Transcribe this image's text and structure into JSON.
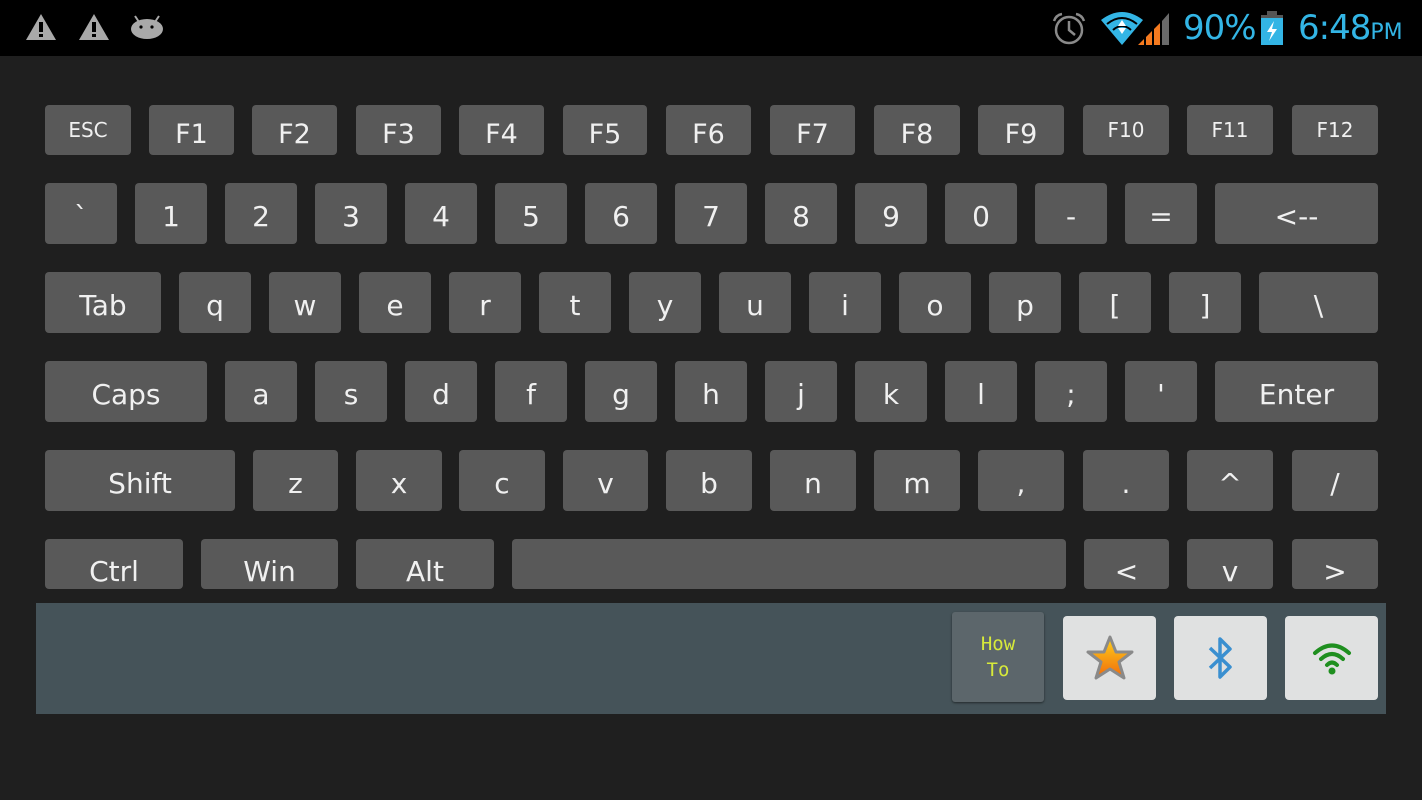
{
  "status_bar": {
    "left_icons": [
      "warning-icon",
      "warning-icon",
      "android-debug-icon"
    ],
    "right_icons": [
      "alarm-icon",
      "wifi-icon",
      "cell-signal-icon",
      "battery-charging-icon"
    ],
    "battery_percent": "90%",
    "time": "6:48",
    "ampm": "PM",
    "accent_color": "#33b5e5"
  },
  "keyboard": {
    "row_function": [
      "ESC",
      "F1",
      "F2",
      "F3",
      "F4",
      "F5",
      "F6",
      "F7",
      "F8",
      "F9",
      "F10",
      "F11",
      "F12"
    ],
    "row_number": [
      "`",
      "1",
      "2",
      "3",
      "4",
      "5",
      "6",
      "7",
      "8",
      "9",
      "0",
      "-",
      "=",
      "<--"
    ],
    "row_qwerty": [
      "Tab",
      "q",
      "w",
      "e",
      "r",
      "t",
      "y",
      "u",
      "i",
      "o",
      "p",
      "[",
      "]",
      "\\"
    ],
    "row_home": [
      "Caps",
      "a",
      "s",
      "d",
      "f",
      "g",
      "h",
      "j",
      "k",
      "l",
      ";",
      "'",
      "Enter"
    ],
    "row_shift": [
      "Shift",
      "z",
      "x",
      "c",
      "v",
      "b",
      "n",
      "m",
      ",",
      ".",
      "^",
      "/"
    ],
    "row_bottom": [
      "Ctrl",
      "Win",
      "Alt",
      "",
      "<",
      "v",
      ">"
    ]
  },
  "toolbar": {
    "howto_line1": "How",
    "howto_line2": "To",
    "buttons": [
      "favorite-star-button",
      "bluetooth-button",
      "wifi-button"
    ],
    "howto_text_color": "#d7ea3a",
    "bluetooth_color": "#3a8fd0",
    "wifi_color": "#1f8f1f"
  }
}
